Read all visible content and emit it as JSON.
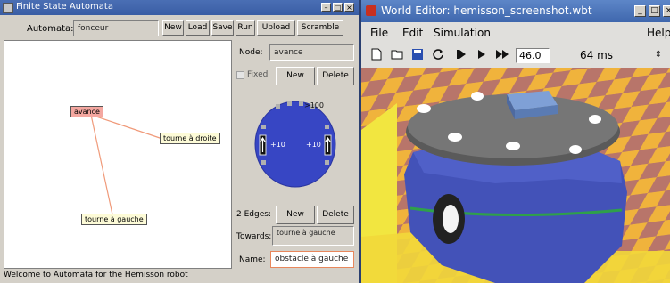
{
  "fsa_window": {
    "title": "Finite State Automata",
    "automata_label": "Automata:",
    "automata_value": "fonceur",
    "toolbar_buttons": [
      "New",
      "Load",
      "Save",
      "Run",
      "Upload",
      "Scramble"
    ],
    "nodes": [
      {
        "label": "avance",
        "state": "active"
      },
      {
        "label": "tourne à droite",
        "state": "normal"
      },
      {
        "label": "tourne à gauche",
        "state": "normal"
      }
    ],
    "node_panel": {
      "node_label": "Node:",
      "node_value": "avance",
      "fixed_label": "Fixed",
      "new_label": "New",
      "delete_label": "Delete",
      "sensor_value": ">100",
      "left_motor": "+10",
      "right_motor": "+10"
    },
    "edge_panel": {
      "edges_label": "2 Edges:",
      "new_label": "New",
      "delete_label": "Delete",
      "towards_label": "Towards:",
      "towards_value": "tourne à gauche",
      "name_label": "Name:",
      "name_value": "obstacle à gauche"
    },
    "status": "Welcome to Automata for the Hemisson robot"
  },
  "world_editor": {
    "title": "World Editor: hemisson_screenshot.wbt",
    "menu": [
      "File",
      "Edit",
      "Simulation",
      "Help"
    ],
    "time_value": "46.0",
    "step_value": "64 ms",
    "colors": {
      "floor_a": "#f0b33c",
      "floor_b": "#b8756a",
      "wall": "#f2e640",
      "robot_body": "#4352b8",
      "robot_top": "#6b6b6b",
      "stripe": "#2fa04a"
    }
  }
}
